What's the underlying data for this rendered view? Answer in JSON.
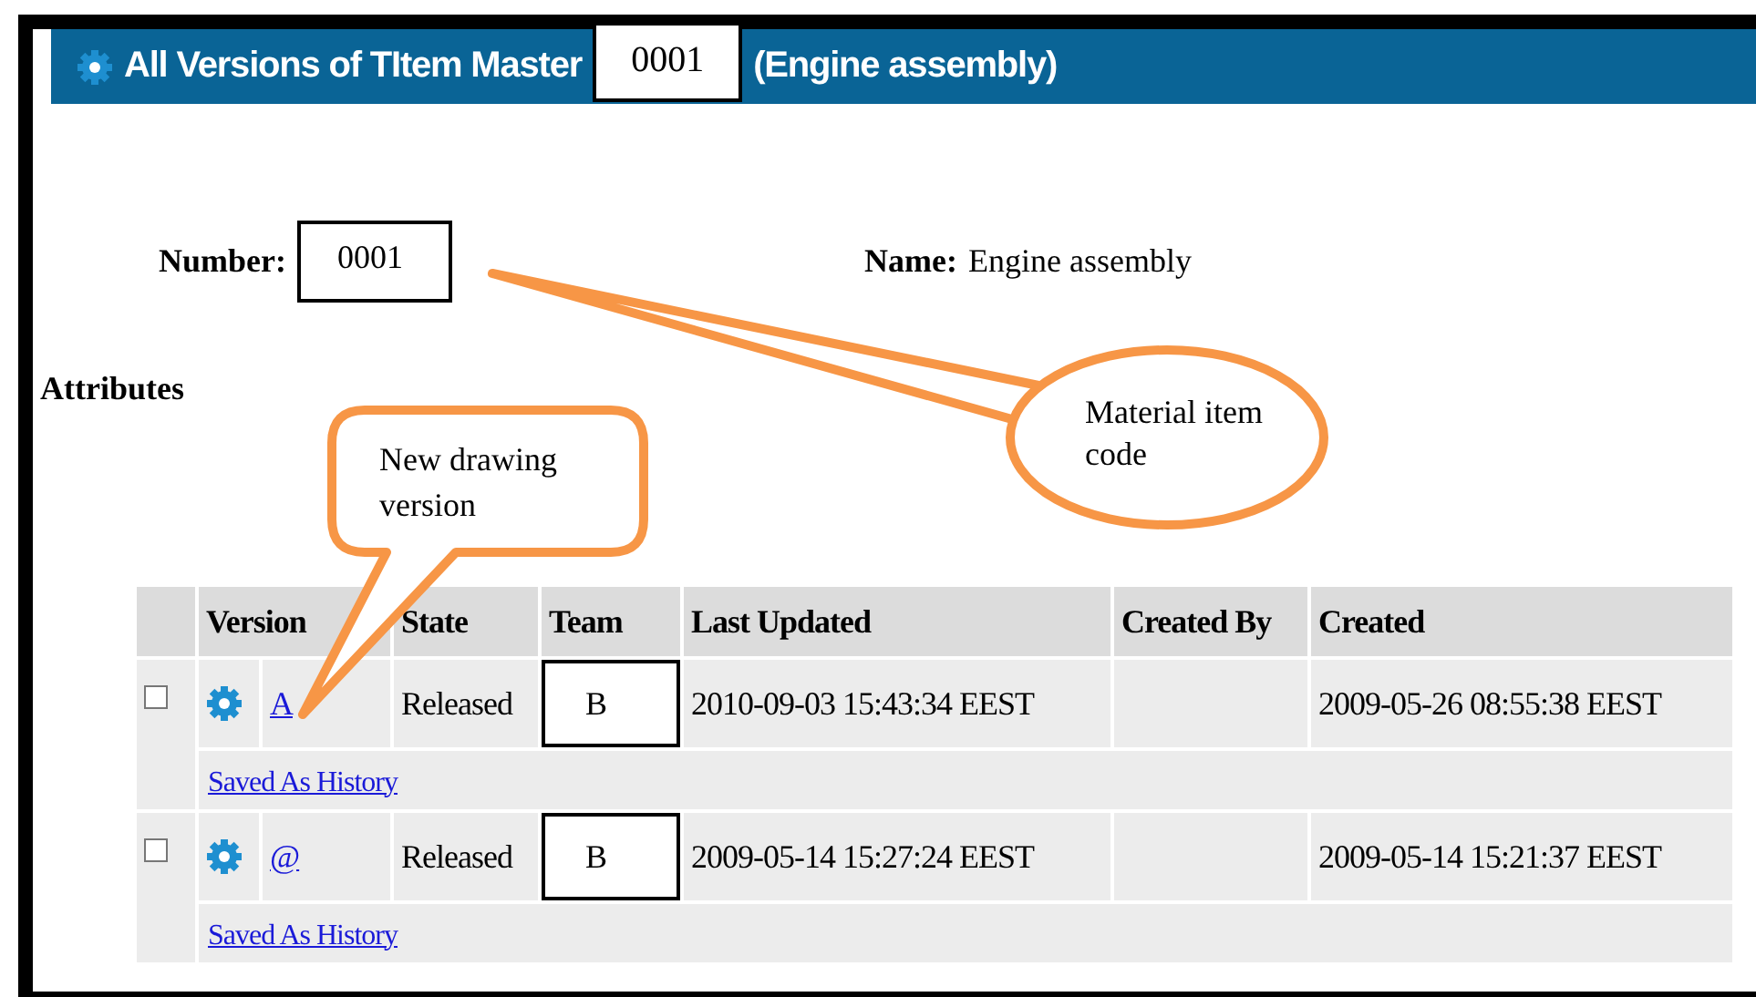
{
  "header": {
    "title": "All Versions of TItem Master",
    "number": "0001",
    "suffix": "(Engine assembly)"
  },
  "fields": [
    {
      "kind": "boxed",
      "label": "Number:",
      "value": "0001"
    },
    {
      "kind": "plain",
      "label": "Name:",
      "value": "Engine assembly"
    }
  ],
  "section": "Attributes",
  "table": {
    "columns": [
      "Version",
      "State",
      "Team",
      "Last Updated",
      "Created By",
      "Created"
    ],
    "rows": [
      {
        "checked": false,
        "version": "A",
        "state": "Released",
        "team": "B",
        "last_updated": "2010-09-03 15:43:34 EEST",
        "created": "2009-05-26 08:55:38 EEST",
        "history_link": "Saved As History"
      },
      {
        "checked": false,
        "version": "@",
        "state": "Released",
        "team": "B",
        "last_updated": "2009-05-14 15:27:24 EEST",
        "created": "2009-05-14 15:21:37 EEST",
        "history_link": "Saved As History"
      }
    ]
  },
  "callouts": [
    {
      "kind": "rounded",
      "text": "New drawing version"
    },
    {
      "kind": "ellipse",
      "text": "Material item code"
    }
  ]
}
